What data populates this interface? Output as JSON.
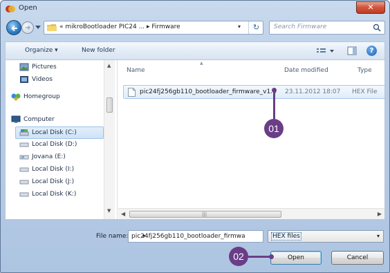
{
  "window": {
    "title": "Open"
  },
  "navigation": {
    "address_text": "« mikroBootloader PIC24 ...  ▸  Firmware",
    "search_placeholder": "Search Firmware"
  },
  "toolbar": {
    "organize_label": "Organize ▾",
    "new_folder_label": "New folder"
  },
  "nav_pane": {
    "items": [
      {
        "label": "Pictures",
        "icon": "pictures-icon"
      },
      {
        "label": "Videos",
        "icon": "videos-icon"
      },
      {
        "label": "Homegroup",
        "icon": "homegroup-icon"
      },
      {
        "label": "Computer",
        "icon": "computer-icon"
      },
      {
        "label": "Local Disk (C:)",
        "icon": "drive-icon"
      },
      {
        "label": "Local Disk (D:)",
        "icon": "drive-icon"
      },
      {
        "label": "Jovana (E:)",
        "icon": "drive-icon"
      },
      {
        "label": "Local Disk (I:)",
        "icon": "drive-icon"
      },
      {
        "label": "Local Disk (J:)",
        "icon": "drive-icon"
      },
      {
        "label": "Local Disk (K:)",
        "icon": "drive-icon"
      }
    ]
  },
  "file_list": {
    "columns": {
      "name": "Name",
      "date": "Date modified",
      "type": "Type"
    },
    "rows": [
      {
        "name": "pic24fj256gb110_bootloader_firmware_v1.0",
        "date": "23.11.2012 18:07",
        "type": "HEX File"
      }
    ]
  },
  "bottom": {
    "file_name_label": "File name:",
    "file_name_value": "pic24fj256gb110_bootloader_firmwa",
    "file_type_value": "HEX files",
    "open_label": "Open",
    "cancel_label": "Cancel"
  },
  "callouts": {
    "first": "01",
    "second": "02"
  },
  "colors": {
    "callout": "#6a3d86",
    "selection": "#cfe3f7",
    "close_button": "#c13a22"
  }
}
